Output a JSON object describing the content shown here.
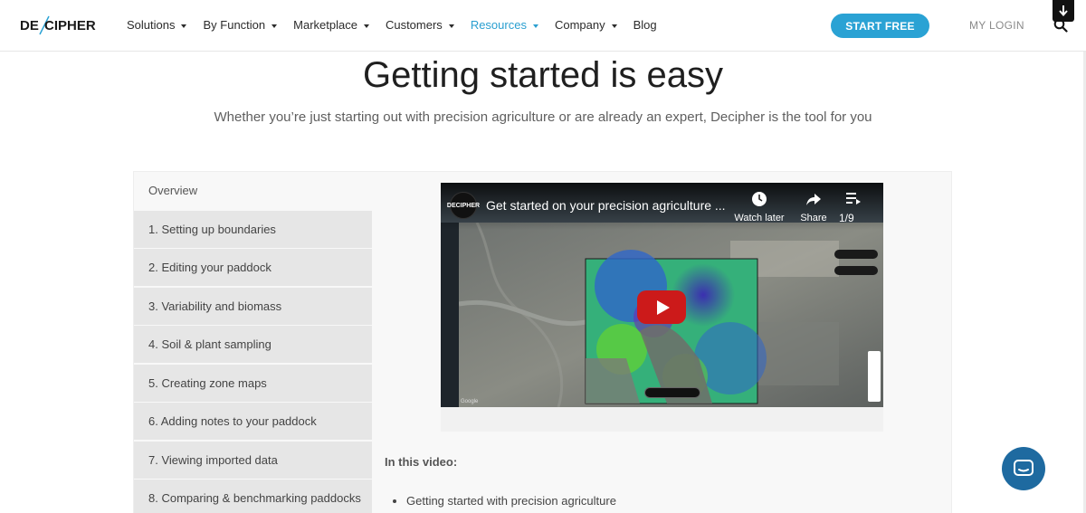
{
  "nav": {
    "logo_text": "DECIPHER",
    "items": [
      {
        "label": "Solutions",
        "dropdown": true,
        "active": false
      },
      {
        "label": "By Function",
        "dropdown": true,
        "active": false
      },
      {
        "label": "Marketplace",
        "dropdown": true,
        "active": false
      },
      {
        "label": "Customers",
        "dropdown": true,
        "active": false
      },
      {
        "label": "Resources",
        "dropdown": true,
        "active": true
      },
      {
        "label": "Company",
        "dropdown": true,
        "active": false
      },
      {
        "label": "Blog",
        "dropdown": false,
        "active": false
      }
    ],
    "start_label": "START FREE",
    "login_label": "MY LOGIN"
  },
  "hero": {
    "title": "Getting started is easy",
    "subtitle": "Whether you’re just starting out with precision agriculture or are already an expert, Decipher is the tool for you"
  },
  "tabs": [
    "Overview",
    "1. Setting up boundaries",
    "2. Editing your paddock",
    "3. Variability and biomass",
    "4. Soil & plant sampling",
    "5. Creating zone maps",
    "6. Adding notes to your paddock",
    "7. Viewing imported data",
    "8. Comparing & benchmarking paddocks"
  ],
  "active_tab": 0,
  "video": {
    "channel_badge": "DECIPHER",
    "title": "Get started on your precision agriculture ...",
    "watch_later_label": "Watch later",
    "share_label": "Share",
    "playlist_count": "1/9",
    "map_credit": "Google"
  },
  "content": {
    "heading": "In this video:",
    "bullets": [
      "Getting started with precision agriculture"
    ]
  },
  "colors": {
    "accent": "#2aa2d4",
    "chat": "#1e6aa0",
    "play": "#cc1a1a"
  }
}
